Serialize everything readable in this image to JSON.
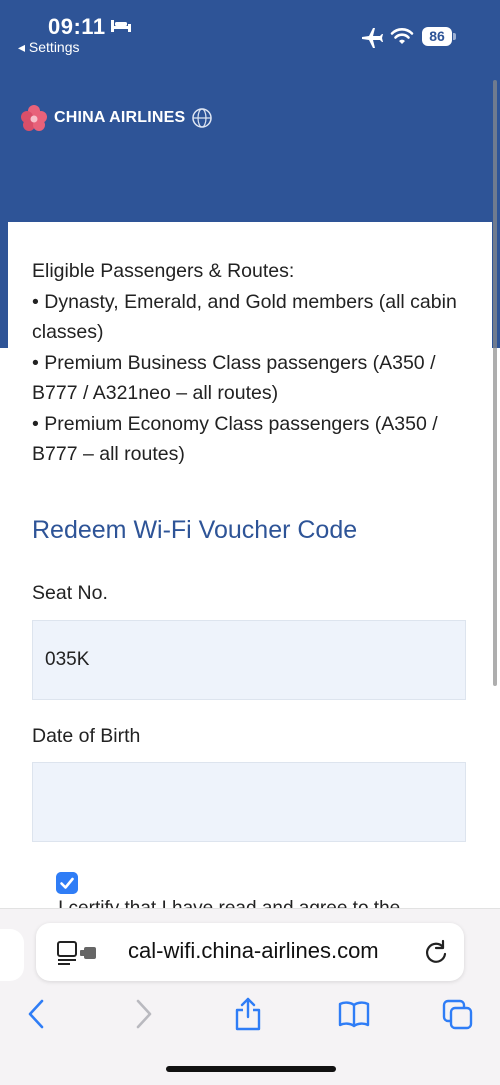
{
  "status_bar": {
    "time": "09:11",
    "back_label": "◂ Settings",
    "battery": "86",
    "icons": [
      "bed-icon",
      "airplane-icon",
      "wifi-icon",
      "battery-icon"
    ]
  },
  "brand": {
    "name": "CHINA AIRLINES",
    "header_color": "#2e5497"
  },
  "eligibility": {
    "heading": "Eligible Passengers & Routes:",
    "items": [
      "• Dynasty, Emerald, and Gold members (all cabin classes)",
      "• Premium Business Class passengers (A350 / B777 / A321neo – all routes)",
      "• Premium Economy Class passengers (A350 / B777 – all routes)"
    ]
  },
  "form": {
    "title": "Redeem Wi-Fi Voucher Code",
    "seat_label": "Seat No.",
    "seat_value": "035K",
    "dob_label": "Date of Birth",
    "dob_value": "",
    "certify_checked": true,
    "certify_text": "I certify that I have read and agree to the"
  },
  "browser": {
    "url": "cal-wifi.china-airlines.com",
    "toolbar_icons": [
      "back-arrow-icon",
      "forward-arrow-icon",
      "share-icon",
      "bookmarks-icon",
      "tabs-icon"
    ]
  },
  "colors": {
    "accent": "#2e5497",
    "checkbox": "#2f7df6",
    "field_bg": "#eef3fb"
  }
}
